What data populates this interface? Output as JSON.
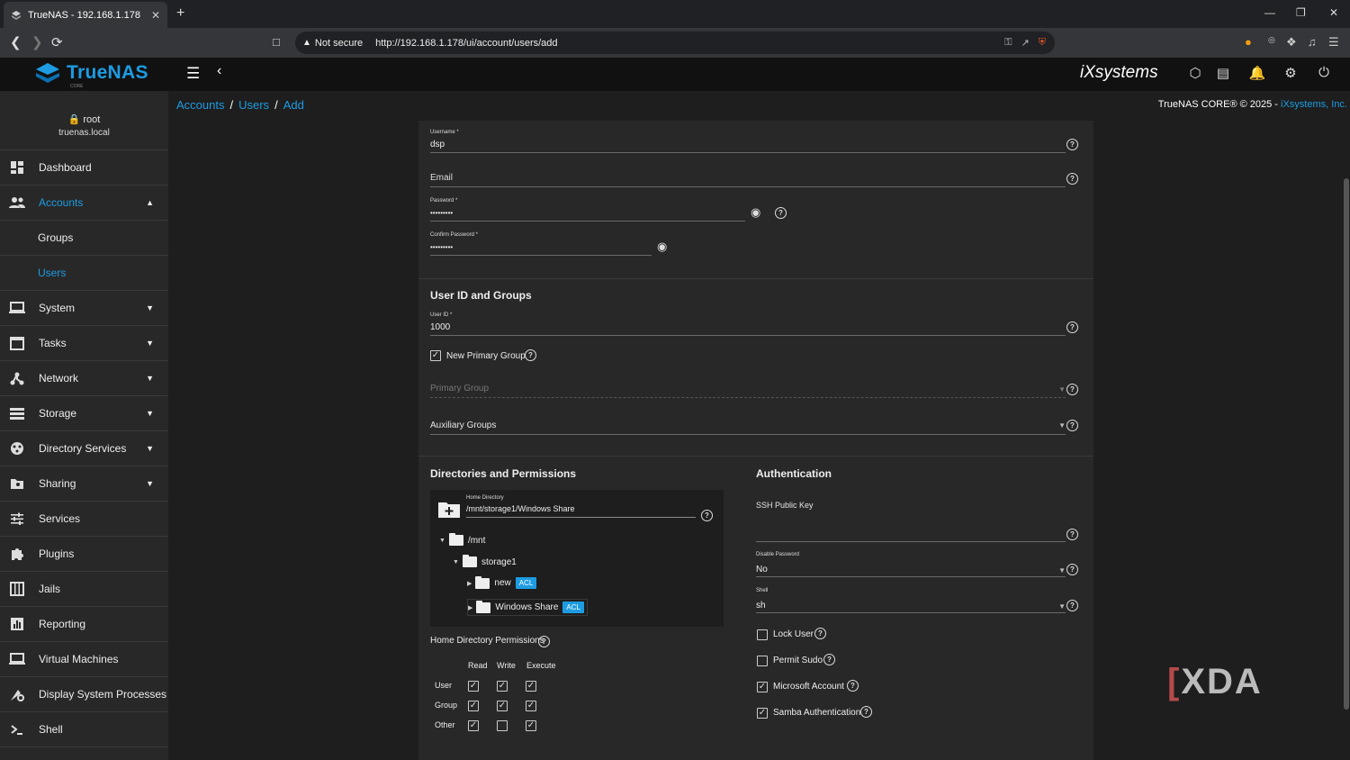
{
  "browser": {
    "tab_title": "TrueNAS - 192.168.1.178",
    "security": "Not secure",
    "url": "http://192.168.1.178/ui/account/users/add",
    "new_tab": "+",
    "close": "✕",
    "minimize": "—",
    "restore": "❐",
    "window_close": "✕"
  },
  "app": {
    "brand": "TrueNAS",
    "brand_sub": "CORE",
    "vendor": "iXsystems"
  },
  "sidebar": {
    "user": "root",
    "host": "truenas.local",
    "items": [
      {
        "label": "Dashboard",
        "icon": "dashboard-icon"
      },
      {
        "label": "Accounts",
        "icon": "people-icon"
      },
      {
        "label": "Groups"
      },
      {
        "label": "Users"
      },
      {
        "label": "System",
        "icon": "laptop-icon"
      },
      {
        "label": "Tasks",
        "icon": "calendar-icon"
      },
      {
        "label": "Network",
        "icon": "network-icon"
      },
      {
        "label": "Storage",
        "icon": "storage-icon"
      },
      {
        "label": "Directory Services",
        "icon": "directory-icon"
      },
      {
        "label": "Sharing",
        "icon": "folder-shared-icon"
      },
      {
        "label": "Services",
        "icon": "tune-icon"
      },
      {
        "label": "Plugins",
        "icon": "puzzle-icon"
      },
      {
        "label": "Jails",
        "icon": "jail-icon"
      },
      {
        "label": "Reporting",
        "icon": "chart-icon"
      },
      {
        "label": "Virtual Machines",
        "icon": "computer-icon"
      },
      {
        "label": "Display System Processes",
        "icon": "processes-icon"
      },
      {
        "label": "Shell",
        "icon": "terminal-icon"
      }
    ]
  },
  "breadcrumb": {
    "a": "Accounts",
    "b": "Users",
    "c": "Add",
    "sep": "/"
  },
  "copyright": {
    "text": "TrueNAS CORE® © 2025 - ",
    "link": "iXsystems, Inc."
  },
  "form": {
    "username_label": "Username *",
    "username": "dsp",
    "email_label": "Email",
    "password_label": "Password *",
    "password": "•••••••••",
    "confirm_label": "Confirm Password *",
    "confirm": "•••••••••",
    "uid_section": "User ID and Groups",
    "uid_label": "User ID *",
    "uid": "1000",
    "new_primary_group": "New Primary Group",
    "primary_group": "Primary Group",
    "aux_groups": "Auxiliary Groups",
    "dir_section": "Directories and Permissions",
    "auth_section": "Authentication",
    "home_label": "Home Directory",
    "home": "/mnt/storage1/Windows Share",
    "tree": {
      "root": "/mnt",
      "child": "storage1",
      "new": "new",
      "share": "Windows Share",
      "acl": "ACL"
    },
    "perm_label": "Home Directory Permissions",
    "perm_cols": [
      "Read",
      "Write",
      "Execute"
    ],
    "perm_rows": [
      "User",
      "Group",
      "Other"
    ],
    "ssh_label": "SSH Public Key",
    "disable_pw_label": "Disable Password",
    "disable_pw": "No",
    "shell_label": "Shell",
    "shell": "sh",
    "lock_user": "Lock User",
    "permit_sudo": "Permit Sudo",
    "ms_account": "Microsoft Account",
    "samba": "Samba Authentication"
  },
  "watermark": {
    "text": "XDA"
  }
}
